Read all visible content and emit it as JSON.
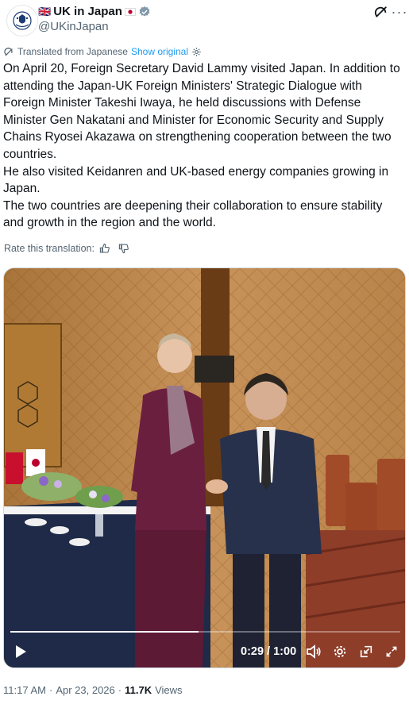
{
  "header": {
    "display_name": "UK in Japan",
    "flag_left": "🇬🇧",
    "handle": "@UKinJapan",
    "verified_color": "#829aab",
    "more_label": "···"
  },
  "translation": {
    "label": "Translated from Japanese",
    "show_original": "Show original"
  },
  "tweet": {
    "text": "On April 20, Foreign Secretary David Lammy visited Japan. In addition to attending the Japan-UK Foreign Ministers' Strategic Dialogue with Foreign Minister Takeshi Iwaya, he held discussions with Defense Minister Gen Nakatani and Minister for Economic Security and Supply Chains Ryosei Akazawa on strengthening cooperation between the two countries.\nHe also visited Keidanren and UK-based energy companies growing in Japan.\nThe two countries are deepening their collaboration to ensure stability and growth in the region and the world."
  },
  "rate": {
    "label": "Rate this translation:"
  },
  "video": {
    "time": "0:29 / 1:00",
    "progress": 0.483
  },
  "footer": {
    "time": "11:17 AM",
    "sep1": "·",
    "date": "Apr 23, 2026",
    "sep2": "·",
    "views_count": "11.7K",
    "views_label": "Views"
  },
  "colors": {
    "link": "#1d9bf0",
    "muted": "#536471",
    "text": "#0f1419"
  }
}
